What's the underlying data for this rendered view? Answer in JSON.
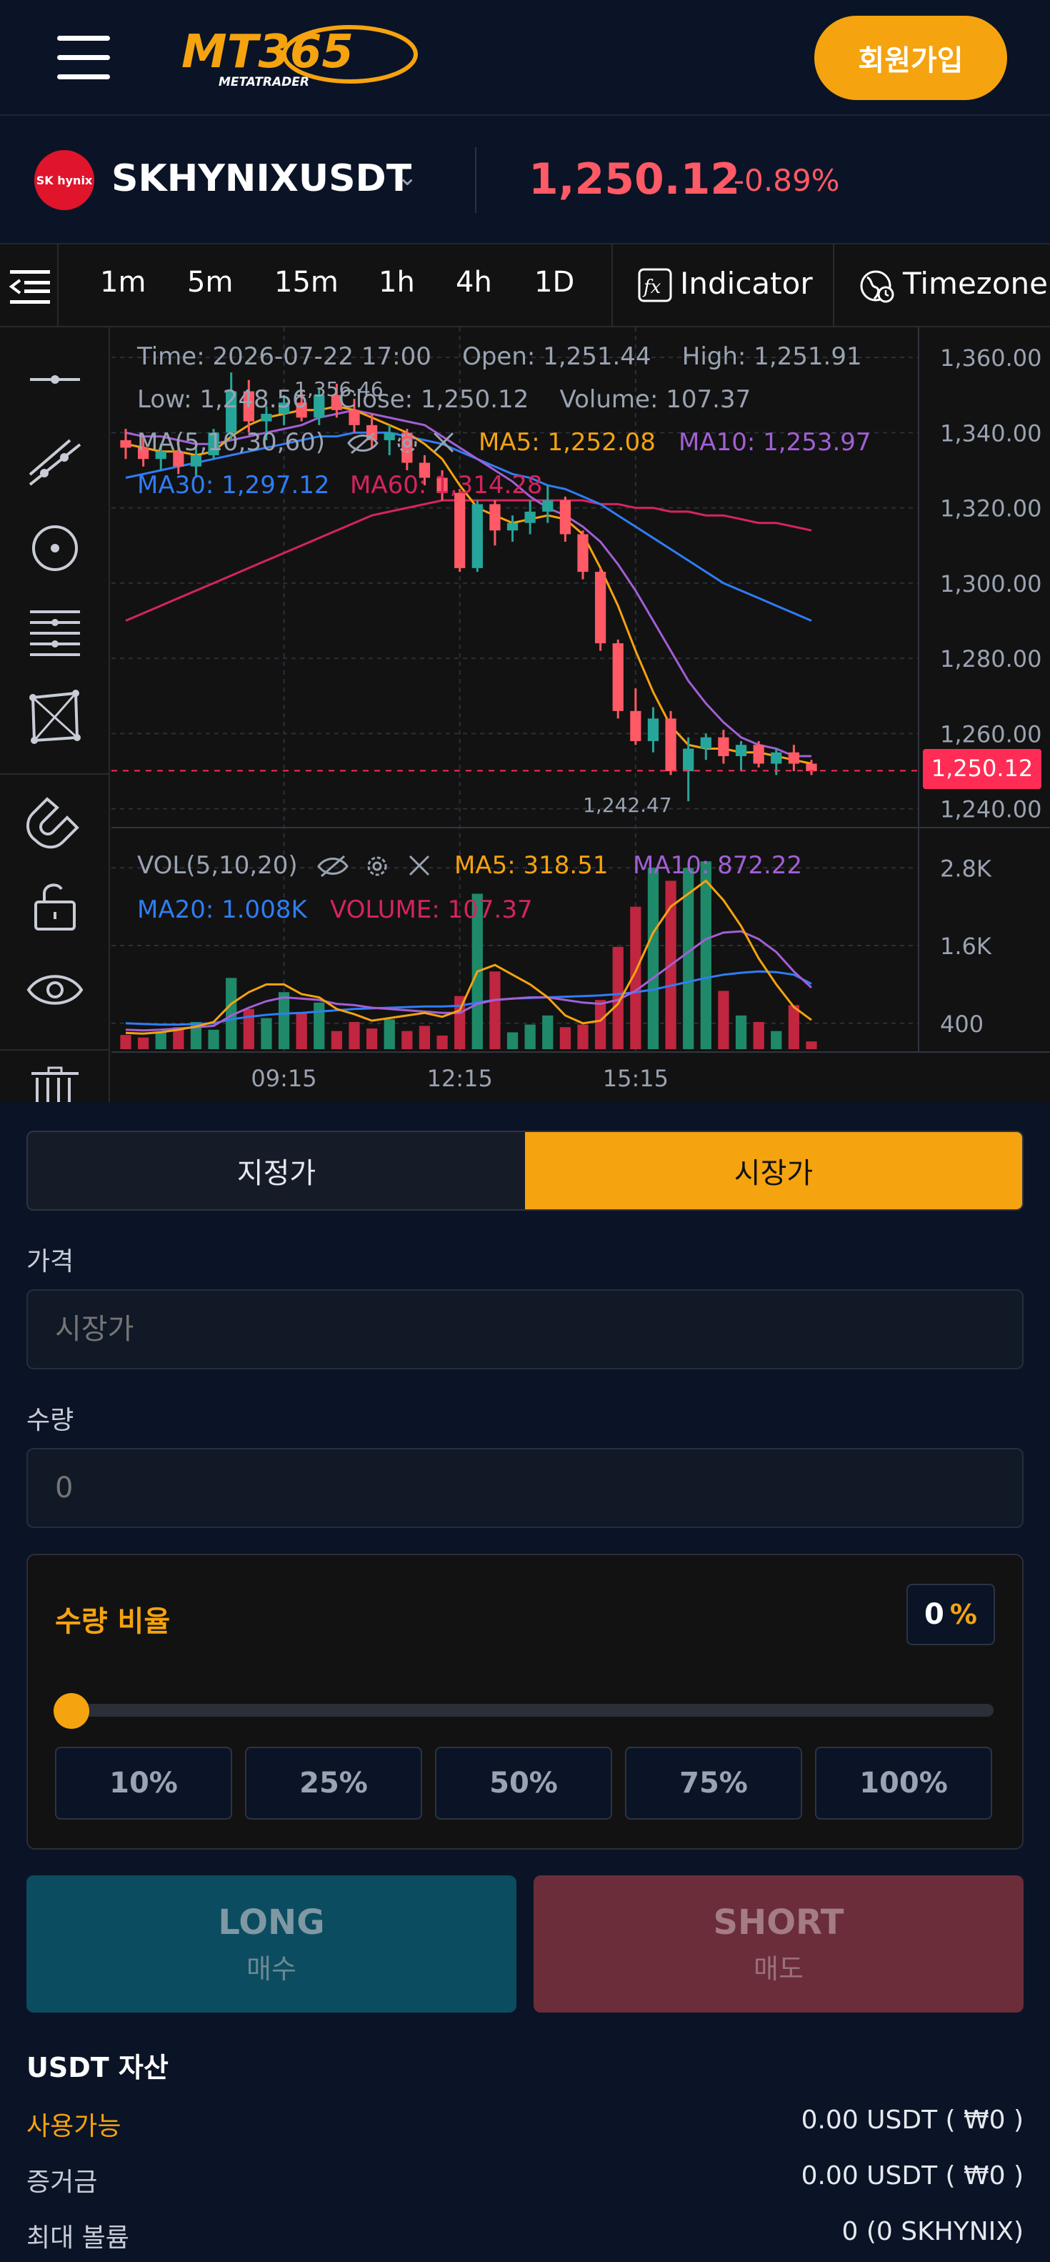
{
  "header": {
    "logo_text": "MT365",
    "logo_subtext": "METATRADER",
    "signup_label": "회원가입"
  },
  "ticker": {
    "coin_logo_text": "SK hynix",
    "symbol": "SKHYNIXUSDT",
    "price": "1,250.12",
    "change": "-0.89%"
  },
  "toolbar": {
    "timeframes": [
      "1m",
      "5m",
      "15m",
      "1h",
      "4h",
      "1D"
    ],
    "indicator_label": "Indicator",
    "timezone_label": "Timezone"
  },
  "chart_info": {
    "line1": "Time: 2026-07-22 17:00    Open: 1,251.44    High: 1,251.91",
    "line2": "Low: 1,248.56    Close: 1,250.12    Volume: 107.37",
    "ma_title": "MA(5,10,30,60)",
    "ma5": "MA5: 1,252.08",
    "ma10": "MA10: 1,253.97",
    "ma30": "MA30: 1,297.12",
    "ma60": "MA60: 1,314.28",
    "high_marker": "1,356.46",
    "low_marker": "1,242.47",
    "vol_title": "VOL(5,10,20)",
    "vol_ma5": "MA5: 318.51",
    "vol_ma10": "MA10: 872.22",
    "vol_ma20": "MA20: 1.008K",
    "vol_volume": "VOLUME: 107.37",
    "last_price_tag": "1,250.12"
  },
  "chart_data": {
    "type": "candlestick",
    "x_ticks": [
      "09:15",
      "12:15",
      "15:15"
    ],
    "price_ticks": [
      "1,360.00",
      "1,340.00",
      "1,320.00",
      "1,300.00",
      "1,280.00",
      "1,260.00",
      "1,240.00"
    ],
    "ylim": [
      1235,
      1368
    ],
    "volume_ticks": [
      "2.8K",
      "1.6K",
      "400"
    ],
    "volume_ylim": [
      0,
      3200
    ],
    "candles": [
      [
        1338,
        1341,
        1333,
        1336
      ],
      [
        1336,
        1339,
        1331,
        1333
      ],
      [
        1333,
        1337,
        1330,
        1335
      ],
      [
        1335,
        1338,
        1329,
        1331
      ],
      [
        1331,
        1336,
        1328,
        1334
      ],
      [
        1334,
        1341,
        1333,
        1340
      ],
      [
        1340,
        1356,
        1338,
        1351
      ],
      [
        1351,
        1354,
        1340,
        1343
      ],
      [
        1343,
        1347,
        1338,
        1345
      ],
      [
        1345,
        1350,
        1342,
        1348
      ],
      [
        1348,
        1351,
        1343,
        1344
      ],
      [
        1344,
        1352,
        1342,
        1350
      ],
      [
        1350,
        1353,
        1344,
        1346
      ],
      [
        1346,
        1349,
        1340,
        1342
      ],
      [
        1342,
        1345,
        1336,
        1338
      ],
      [
        1338,
        1342,
        1334,
        1340
      ],
      [
        1340,
        1341,
        1330,
        1332
      ],
      [
        1332,
        1334,
        1326,
        1328
      ],
      [
        1328,
        1330,
        1322,
        1324
      ],
      [
        1324,
        1325,
        1303,
        1304
      ],
      [
        1304,
        1322,
        1303,
        1321
      ],
      [
        1321,
        1322,
        1310,
        1314
      ],
      [
        1314,
        1318,
        1311,
        1316
      ],
      [
        1316,
        1322,
        1313,
        1319
      ],
      [
        1319,
        1326,
        1316,
        1322
      ],
      [
        1322,
        1323,
        1311,
        1313
      ],
      [
        1313,
        1314,
        1301,
        1303
      ],
      [
        1303,
        1304,
        1282,
        1284
      ],
      [
        1284,
        1285,
        1264,
        1266
      ],
      [
        1266,
        1272,
        1257,
        1258
      ],
      [
        1258,
        1267,
        1255,
        1264
      ],
      [
        1264,
        1266,
        1249,
        1250
      ],
      [
        1250,
        1259,
        1242,
        1256
      ],
      [
        1256,
        1260,
        1253,
        1259
      ],
      [
        1259,
        1261,
        1252,
        1254
      ],
      [
        1254,
        1258,
        1250,
        1257
      ],
      [
        1257,
        1258,
        1251,
        1252
      ],
      [
        1252,
        1256,
        1249,
        1255
      ],
      [
        1255,
        1257,
        1250,
        1252
      ],
      [
        1252,
        1253,
        1249,
        1250
      ]
    ],
    "volumes": [
      220,
      180,
      260,
      340,
      420,
      300,
      1100,
      620,
      480,
      880,
      560,
      720,
      280,
      420,
      320,
      460,
      280,
      360,
      210,
      820,
      2400,
      1200,
      260,
      380,
      520,
      340,
      380,
      760,
      1580,
      2200,
      2800,
      2600,
      2800,
      2900,
      900,
      520,
      420,
      280,
      680,
      120
    ],
    "ma5": [
      1337,
      1336,
      1335,
      1335,
      1334,
      1335,
      1339,
      1342,
      1344,
      1345,
      1346,
      1346,
      1347,
      1346,
      1344,
      1342,
      1340,
      1337,
      1333,
      1326,
      1320,
      1318,
      1316,
      1317,
      1318,
      1317,
      1313,
      1304,
      1294,
      1282,
      1271,
      1262,
      1257,
      1256,
      1256,
      1255,
      1255,
      1254,
      1253,
      1252
    ],
    "ma10": [
      1340,
      1339,
      1339,
      1338,
      1337,
      1337,
      1338,
      1339,
      1340,
      1341,
      1342,
      1344,
      1345,
      1346,
      1345,
      1344,
      1343,
      1342,
      1339,
      1336,
      1333,
      1330,
      1327,
      1323,
      1320,
      1318,
      1315,
      1311,
      1305,
      1298,
      1290,
      1282,
      1274,
      1268,
      1263,
      1259,
      1257,
      1256,
      1254,
      1254
    ],
    "ma30": [
      1328,
      1329,
      1330,
      1331,
      1332,
      1333,
      1334,
      1335,
      1336,
      1337,
      1338,
      1339,
      1339,
      1340,
      1340,
      1340,
      1339,
      1338,
      1337,
      1335,
      1333,
      1331,
      1329,
      1328,
      1326,
      1325,
      1323,
      1321,
      1318,
      1315,
      1312,
      1309,
      1306,
      1303,
      1300,
      1298,
      1296,
      1294,
      1292,
      1290
    ],
    "ma60": [
      1290,
      1292,
      1294,
      1296,
      1298,
      1300,
      1302,
      1304,
      1306,
      1308,
      1310,
      1312,
      1314,
      1316,
      1318,
      1319,
      1320,
      1321,
      1322,
      1322,
      1322,
      1322,
      1322,
      1322,
      1322,
      1322,
      1322,
      1321,
      1321,
      1320,
      1320,
      1319,
      1319,
      1318,
      1318,
      1317,
      1316,
      1316,
      1315,
      1314
    ],
    "vol_ma5": [
      250,
      240,
      260,
      300,
      350,
      420,
      700,
      880,
      1000,
      1000,
      850,
      800,
      620,
      540,
      440,
      480,
      520,
      560,
      500,
      600,
      1200,
      1300,
      1150,
      1000,
      800,
      520,
      400,
      440,
      700,
      1200,
      1800,
      2200,
      2400,
      2600,
      2300,
      1900,
      1400,
      1000,
      650,
      450
    ],
    "vol_ma10": [
      300,
      290,
      300,
      320,
      340,
      360,
      520,
      640,
      740,
      800,
      780,
      760,
      700,
      680,
      640,
      620,
      600,
      580,
      560,
      560,
      700,
      760,
      780,
      800,
      800,
      760,
      720,
      700,
      760,
      900,
      1100,
      1300,
      1500,
      1700,
      1800,
      1820,
      1700,
      1500,
      1200,
      950
    ],
    "vol_ma20": [
      400,
      390,
      380,
      380,
      390,
      400,
      460,
      500,
      530,
      550,
      560,
      580,
      600,
      620,
      630,
      640,
      650,
      660,
      660,
      670,
      720,
      760,
      780,
      790,
      800,
      810,
      820,
      830,
      850,
      880,
      920,
      980,
      1040,
      1100,
      1150,
      1180,
      1200,
      1190,
      1150,
      1008
    ]
  },
  "order": {
    "tab_limit": "지정가",
    "tab_market": "시장가",
    "price_label": "가격",
    "price_placeholder": "시장가",
    "qty_label": "수량",
    "qty_placeholder": "0",
    "ratio_title": "수량 비율",
    "ratio_value": "0",
    "ratio_unit": "%",
    "ratio_fraction": 0,
    "pct_buttons": [
      "10%",
      "25%",
      "50%",
      "75%",
      "100%"
    ],
    "long_label": "LONG",
    "long_sub": "매수",
    "short_label": "SHORT",
    "short_sub": "매도"
  },
  "assets": {
    "title": "USDT 자산",
    "available_label": "사용가능",
    "available_value": "0.00 USDT ( ₩0 )",
    "margin_label": "증거금",
    "margin_value": "0.00 USDT ( ₩0 )",
    "max_label": "최대 볼륨",
    "max_value": "0 (0 SKHYNIX)"
  },
  "colors": {
    "accent": "#f5a30f",
    "up": "#26a69a",
    "down": "#ff5a65",
    "ma5": "#f5a30f",
    "ma10": "#a35fd6",
    "ma30": "#2f7df6",
    "ma60": "#d6245e"
  }
}
